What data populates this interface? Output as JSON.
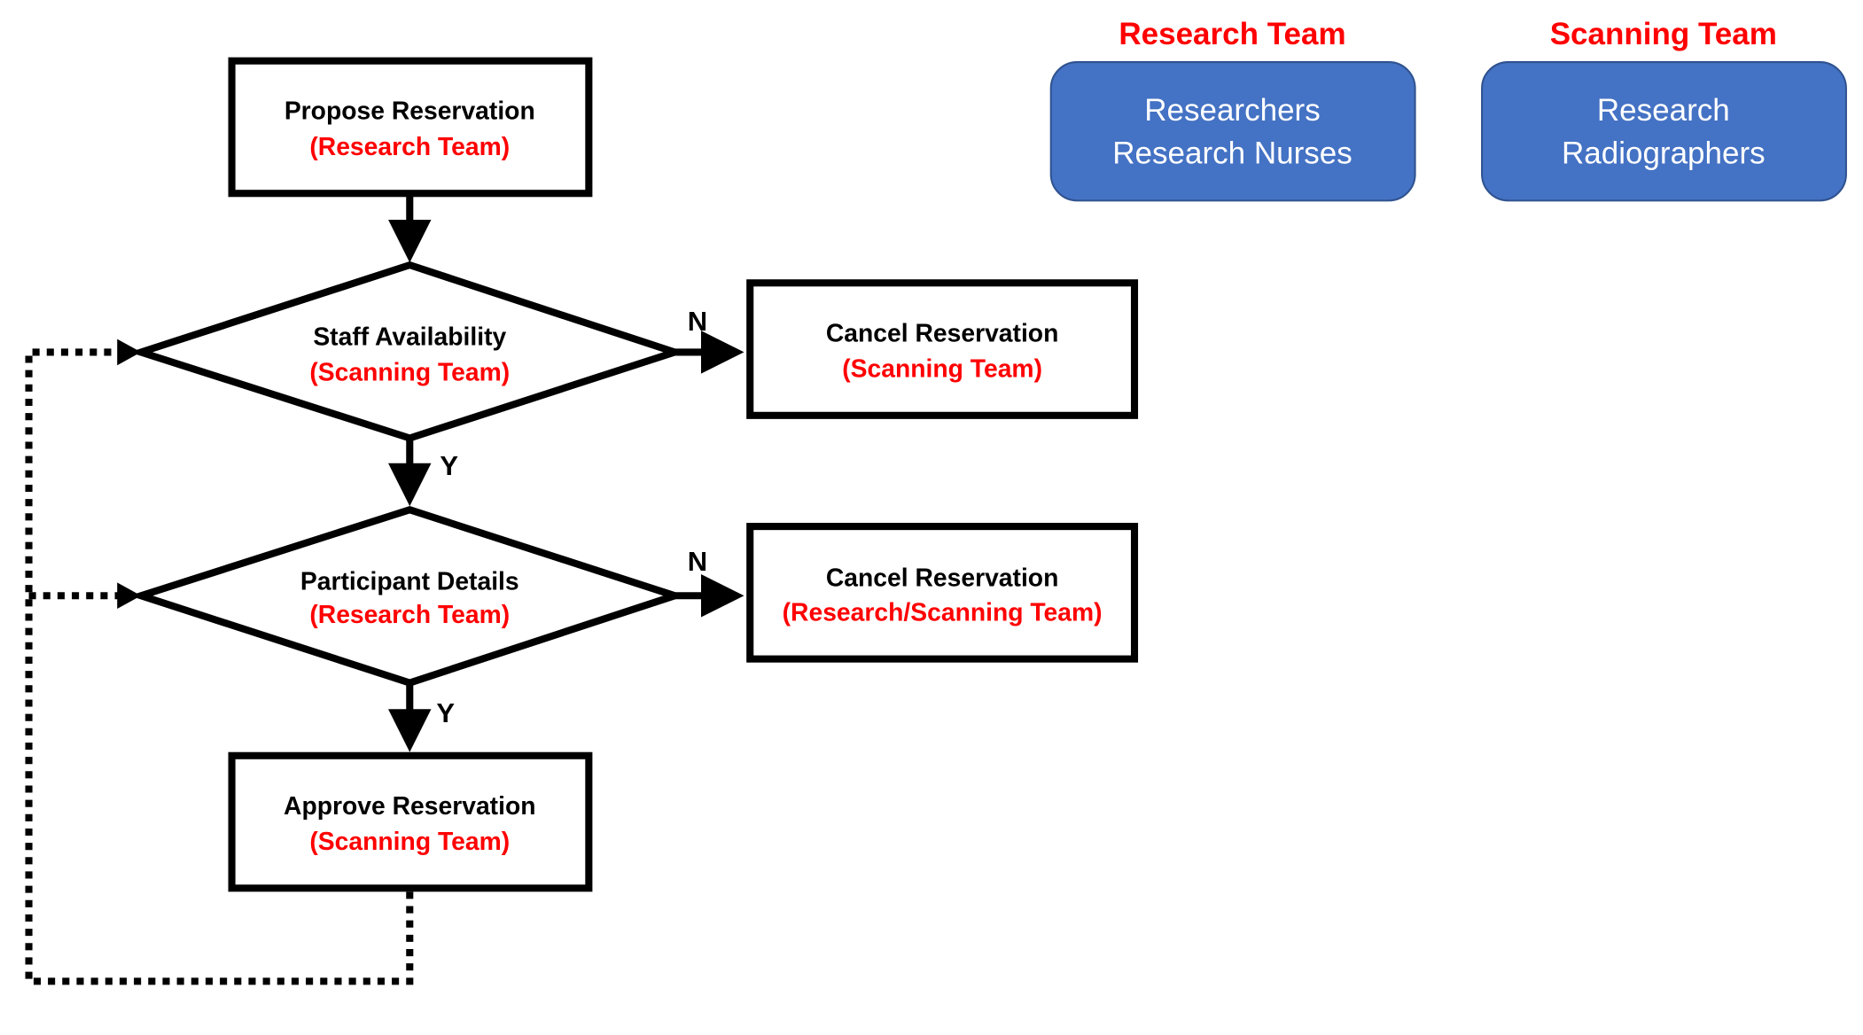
{
  "colors": {
    "role_fill": "#4472C4",
    "role_stroke": "#2F528F",
    "team_text": "#FF0000",
    "line": "#000000"
  },
  "nodes": {
    "propose": {
      "title": "Propose Reservation",
      "team": "(Research Team)"
    },
    "staff": {
      "title": "Staff Availability",
      "team": "(Scanning Team)"
    },
    "cancel1": {
      "title": "Cancel Reservation",
      "team": "(Scanning Team)"
    },
    "participant": {
      "title": "Participant Details",
      "team": "(Research Team)"
    },
    "cancel2": {
      "title": "Cancel Reservation",
      "team": "(Research/Scanning Team)"
    },
    "approve": {
      "title": "Approve Reservation",
      "team": "(Scanning Team)"
    }
  },
  "edges": {
    "staff_no": "N",
    "staff_yes": "Y",
    "participant_no": "N",
    "participant_yes": "Y"
  },
  "legend": [
    {
      "heading": "Research Team",
      "line1": "Researchers",
      "line2": "Research Nurses"
    },
    {
      "heading": "Scanning Team",
      "line1": "Research",
      "line2": "Radiographers"
    }
  ]
}
